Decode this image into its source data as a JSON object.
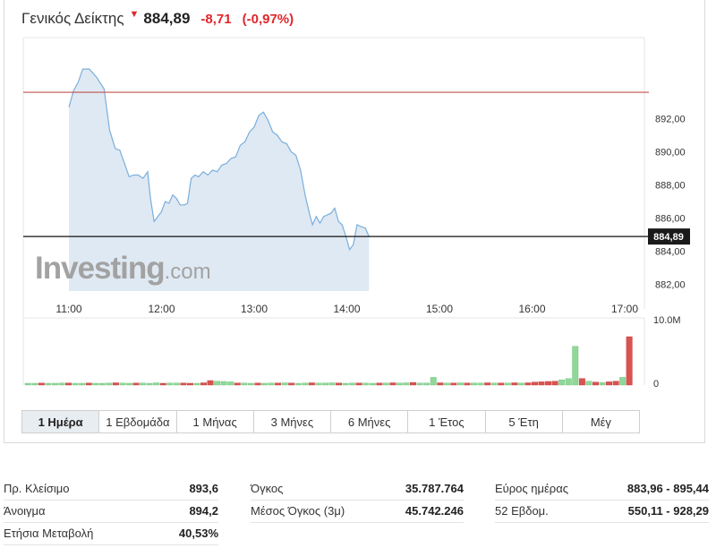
{
  "header": {
    "title": "Γενικός Δείκτης",
    "arrow": "▼",
    "price": "884,89",
    "change": "-8,71",
    "change_pct": "(-0,97%)"
  },
  "chart_data": {
    "type": "area",
    "title": "",
    "x_labels": [
      "11:00",
      "12:00",
      "13:00",
      "14:00",
      "15:00",
      "16:00",
      "17:00"
    ],
    "y_ticks": [
      "892,00",
      "890,00",
      "888,00",
      "886,00",
      "884,00",
      "882,00"
    ],
    "ylim": [
      881.6,
      896.9
    ],
    "previous_close": 893.6,
    "last_value": 884.89,
    "last_value_label": "884,89",
    "watermark_bold": "Investing",
    "watermark_light": ".com",
    "line_color": "#7aaedc",
    "fill_color": "#dfe9f3",
    "prev_close_color": "#c0504d",
    "series": [
      {
        "x": 0.0,
        "y": 892.7
      },
      {
        "x": 0.05,
        "y": 893.7
      },
      {
        "x": 0.1,
        "y": 894.2
      },
      {
        "x": 0.15,
        "y": 895.0
      },
      {
        "x": 0.22,
        "y": 895.0
      },
      {
        "x": 0.3,
        "y": 894.5
      },
      {
        "x": 0.38,
        "y": 893.8
      },
      {
        "x": 0.44,
        "y": 891.3
      },
      {
        "x": 0.5,
        "y": 890.2
      },
      {
        "x": 0.55,
        "y": 890.1
      },
      {
        "x": 0.6,
        "y": 889.3
      },
      {
        "x": 0.65,
        "y": 888.5
      },
      {
        "x": 0.7,
        "y": 888.6
      },
      {
        "x": 0.75,
        "y": 888.6
      },
      {
        "x": 0.8,
        "y": 888.4
      },
      {
        "x": 0.85,
        "y": 888.8
      },
      {
        "x": 0.88,
        "y": 887.2
      },
      {
        "x": 0.92,
        "y": 885.8
      },
      {
        "x": 0.96,
        "y": 886.1
      },
      {
        "x": 1.0,
        "y": 886.4
      },
      {
        "x": 1.04,
        "y": 887.0
      },
      {
        "x": 1.08,
        "y": 886.9
      },
      {
        "x": 1.12,
        "y": 887.4
      },
      {
        "x": 1.16,
        "y": 887.2
      },
      {
        "x": 1.2,
        "y": 886.8
      },
      {
        "x": 1.25,
        "y": 886.8
      },
      {
        "x": 1.28,
        "y": 886.9
      },
      {
        "x": 1.32,
        "y": 888.4
      },
      {
        "x": 1.36,
        "y": 888.6
      },
      {
        "x": 1.4,
        "y": 888.5
      },
      {
        "x": 1.45,
        "y": 888.8
      },
      {
        "x": 1.5,
        "y": 888.6
      },
      {
        "x": 1.55,
        "y": 888.9
      },
      {
        "x": 1.6,
        "y": 888.8
      },
      {
        "x": 1.65,
        "y": 889.2
      },
      {
        "x": 1.7,
        "y": 889.3
      },
      {
        "x": 1.75,
        "y": 889.6
      },
      {
        "x": 1.8,
        "y": 889.7
      },
      {
        "x": 1.85,
        "y": 890.4
      },
      {
        "x": 1.9,
        "y": 890.6
      },
      {
        "x": 1.95,
        "y": 891.2
      },
      {
        "x": 2.0,
        "y": 891.5
      },
      {
        "x": 2.05,
        "y": 892.2
      },
      {
        "x": 2.1,
        "y": 892.4
      },
      {
        "x": 2.15,
        "y": 891.9
      },
      {
        "x": 2.2,
        "y": 891.2
      },
      {
        "x": 2.25,
        "y": 891.0
      },
      {
        "x": 2.3,
        "y": 890.6
      },
      {
        "x": 2.35,
        "y": 890.5
      },
      {
        "x": 2.4,
        "y": 890.0
      },
      {
        "x": 2.45,
        "y": 889.8
      },
      {
        "x": 2.5,
        "y": 888.9
      },
      {
        "x": 2.55,
        "y": 887.4
      },
      {
        "x": 2.6,
        "y": 886.2
      },
      {
        "x": 2.63,
        "y": 885.6
      },
      {
        "x": 2.67,
        "y": 886.1
      },
      {
        "x": 2.71,
        "y": 885.7
      },
      {
        "x": 2.75,
        "y": 886.1
      },
      {
        "x": 2.79,
        "y": 886.2
      },
      {
        "x": 2.83,
        "y": 886.3
      },
      {
        "x": 2.87,
        "y": 886.6
      },
      {
        "x": 2.91,
        "y": 885.8
      },
      {
        "x": 2.95,
        "y": 885.6
      },
      {
        "x": 2.99,
        "y": 884.9
      },
      {
        "x": 3.03,
        "y": 884.1
      },
      {
        "x": 3.07,
        "y": 884.4
      },
      {
        "x": 3.11,
        "y": 885.6
      },
      {
        "x": 3.15,
        "y": 885.5
      },
      {
        "x": 3.2,
        "y": 885.4
      },
      {
        "x": 3.24,
        "y": 884.89
      }
    ]
  },
  "volume_data": {
    "y_ticks": [
      "10.0M",
      "0"
    ],
    "max": 10000000,
    "up_color": "#90d89a",
    "down_color": "#d9534f",
    "bars": [
      {
        "v": 0.25,
        "d": "u"
      },
      {
        "v": 0.25,
        "d": "u"
      },
      {
        "v": 0.3,
        "d": "d"
      },
      {
        "v": 0.25,
        "d": "u"
      },
      {
        "v": 0.25,
        "d": "u"
      },
      {
        "v": 0.3,
        "d": "u"
      },
      {
        "v": 0.3,
        "d": "d"
      },
      {
        "v": 0.25,
        "d": "u"
      },
      {
        "v": 0.25,
        "d": "u"
      },
      {
        "v": 0.3,
        "d": "d"
      },
      {
        "v": 0.25,
        "d": "u"
      },
      {
        "v": 0.25,
        "d": "u"
      },
      {
        "v": 0.3,
        "d": "u"
      },
      {
        "v": 0.35,
        "d": "d"
      },
      {
        "v": 0.3,
        "d": "u"
      },
      {
        "v": 0.25,
        "d": "u"
      },
      {
        "v": 0.3,
        "d": "d"
      },
      {
        "v": 0.3,
        "d": "u"
      },
      {
        "v": 0.25,
        "d": "u"
      },
      {
        "v": 0.35,
        "d": "u"
      },
      {
        "v": 0.25,
        "d": "d"
      },
      {
        "v": 0.3,
        "d": "u"
      },
      {
        "v": 0.3,
        "d": "u"
      },
      {
        "v": 0.3,
        "d": "d"
      },
      {
        "v": 0.25,
        "d": "d"
      },
      {
        "v": 0.25,
        "d": "u"
      },
      {
        "v": 0.35,
        "d": "d"
      },
      {
        "v": 0.7,
        "d": "d"
      },
      {
        "v": 0.6,
        "d": "u"
      },
      {
        "v": 0.55,
        "d": "u"
      },
      {
        "v": 0.5,
        "d": "u"
      },
      {
        "v": 0.3,
        "d": "d"
      },
      {
        "v": 0.3,
        "d": "u"
      },
      {
        "v": 0.25,
        "d": "u"
      },
      {
        "v": 0.3,
        "d": "d"
      },
      {
        "v": 0.25,
        "d": "u"
      },
      {
        "v": 0.3,
        "d": "u"
      },
      {
        "v": 0.3,
        "d": "d"
      },
      {
        "v": 0.35,
        "d": "u"
      },
      {
        "v": 0.3,
        "d": "d"
      },
      {
        "v": 0.25,
        "d": "u"
      },
      {
        "v": 0.3,
        "d": "u"
      },
      {
        "v": 0.35,
        "d": "d"
      },
      {
        "v": 0.3,
        "d": "u"
      },
      {
        "v": 0.3,
        "d": "u"
      },
      {
        "v": 0.35,
        "d": "u"
      },
      {
        "v": 0.3,
        "d": "d"
      },
      {
        "v": 0.25,
        "d": "u"
      },
      {
        "v": 0.3,
        "d": "u"
      },
      {
        "v": 0.3,
        "d": "d"
      },
      {
        "v": 0.3,
        "d": "u"
      },
      {
        "v": 0.25,
        "d": "u"
      },
      {
        "v": 0.3,
        "d": "d"
      },
      {
        "v": 0.3,
        "d": "u"
      },
      {
        "v": 0.35,
        "d": "d"
      },
      {
        "v": 0.3,
        "d": "u"
      },
      {
        "v": 0.35,
        "d": "u"
      },
      {
        "v": 0.4,
        "d": "d"
      },
      {
        "v": 0.3,
        "d": "u"
      },
      {
        "v": 0.3,
        "d": "u"
      },
      {
        "v": 1.2,
        "d": "u"
      },
      {
        "v": 0.35,
        "d": "d"
      },
      {
        "v": 0.3,
        "d": "u"
      },
      {
        "v": 0.3,
        "d": "d"
      },
      {
        "v": 0.35,
        "d": "u"
      },
      {
        "v": 0.3,
        "d": "d"
      },
      {
        "v": 0.3,
        "d": "u"
      },
      {
        "v": 0.3,
        "d": "u"
      },
      {
        "v": 0.35,
        "d": "d"
      },
      {
        "v": 0.3,
        "d": "u"
      },
      {
        "v": 0.3,
        "d": "d"
      },
      {
        "v": 0.3,
        "d": "u"
      },
      {
        "v": 0.35,
        "d": "d"
      },
      {
        "v": 0.3,
        "d": "u"
      },
      {
        "v": 0.35,
        "d": "d"
      },
      {
        "v": 0.45,
        "d": "d"
      },
      {
        "v": 0.5,
        "d": "d"
      },
      {
        "v": 0.55,
        "d": "d"
      },
      {
        "v": 0.6,
        "d": "d"
      },
      {
        "v": 0.8,
        "d": "u"
      },
      {
        "v": 1.0,
        "d": "u"
      },
      {
        "v": 6.0,
        "d": "u"
      },
      {
        "v": 1.0,
        "d": "d"
      },
      {
        "v": 0.6,
        "d": "u"
      },
      {
        "v": 0.45,
        "d": "d"
      },
      {
        "v": 0.4,
        "d": "u"
      },
      {
        "v": 0.5,
        "d": "d"
      },
      {
        "v": 0.6,
        "d": "d"
      },
      {
        "v": 1.2,
        "d": "u"
      },
      {
        "v": 7.5,
        "d": "d"
      }
    ]
  },
  "tabs": [
    "1 Ημέρα",
    "1 Εβδομάδα",
    "1 Μήνας",
    "3 Μήνες",
    "6 Μήνες",
    "1 Έτος",
    "5 Έτη",
    "Μέγ"
  ],
  "stats": {
    "col1": [
      {
        "label": "Πρ. Κλείσιμο",
        "value": "893,6"
      },
      {
        "label": "Άνοιγμα",
        "value": "894,2"
      },
      {
        "label": "Ετήσια Μεταβολή",
        "value": "40,53%"
      }
    ],
    "col2": [
      {
        "label": "Όγκος",
        "value": "35.787.764"
      },
      {
        "label": "Μέσος Όγκος (3μ)",
        "value": "45.742.246"
      }
    ],
    "col3": [
      {
        "label": "Εύρος ημέρας",
        "value": "883,96 - 895,44"
      },
      {
        "label": "52 Εβδομ.",
        "value": "550,11 - 928,29"
      }
    ]
  }
}
